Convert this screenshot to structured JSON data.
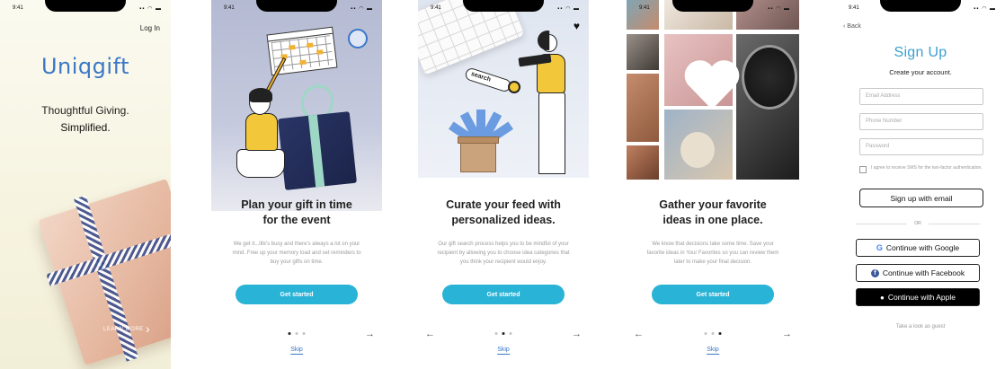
{
  "status": {
    "time": "9:41",
    "icons": "▪▪ ◠ ▬"
  },
  "welcome": {
    "login": "Log In",
    "brand": "Uniqgift",
    "tagline_line1": "Thoughtful Giving.",
    "tagline_line2": "Simplified.",
    "learn_more": "LEARN MORE",
    "learn_arrow": "›"
  },
  "onboarding": [
    {
      "title_line1": "Plan your gift in time",
      "title_line2": "for the event",
      "body": "We get it...life's busy and there's always a lot on your mind. Free up your memory load and set reminders to buy your gifts on time.",
      "cta": "Get started",
      "skip": "Skip",
      "active_dot": 0
    },
    {
      "title_line1": "Curate your feed with",
      "title_line2": "personalized ideas.",
      "body": "Our gift search process helps you to be mindful of your recipient by allowing you to choose idea categories that you think your recipient would enjoy.",
      "cta": "Get started",
      "skip": "Skip",
      "search_label": "search",
      "active_dot": 1
    },
    {
      "title_line1": "Gather your favorite",
      "title_line2": "ideas in one place.",
      "body": "We know that decisions take some time. Save your favorite ideas in Your Favorites so you can review them later to make your final decision.",
      "cta": "Get started",
      "skip": "Skip",
      "active_dot": 2
    }
  ],
  "arrows": {
    "next": "→",
    "prev": "←"
  },
  "signup": {
    "back": "Back",
    "title": "Sign Up",
    "subtitle": "Create your account.",
    "email_placeholder": "Email Address",
    "phone_placeholder": "Phone Number",
    "password_placeholder": "Password",
    "consent": "I agree to receive SMS for the two-factor authentication.",
    "email_button": "Sign up with email",
    "or": "OR",
    "google_button": "Continue with Google",
    "facebook_button": "Continue with Facebook",
    "apple_button": "Continue with Apple",
    "guest": "Take a look as guest"
  },
  "colors": {
    "accent": "#29b3d6",
    "brand": "#3a78c6",
    "illustration_yellow": "#f2c83a"
  },
  "icons": [
    "chevron-left-icon",
    "arrow-right-icon",
    "arrow-left-icon",
    "heart-icon",
    "google-icon",
    "facebook-icon",
    "apple-icon",
    "clock-icon"
  ]
}
